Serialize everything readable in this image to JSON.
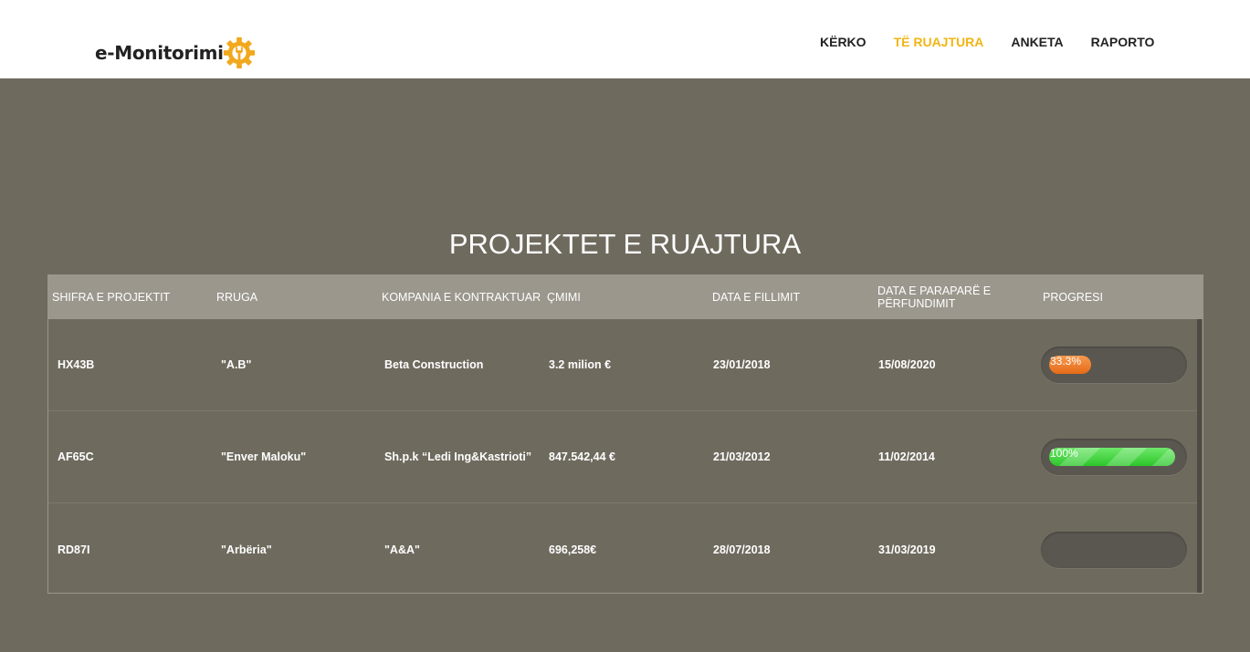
{
  "header": {
    "logo_text": "e-Monitorimi",
    "nav": [
      {
        "label": "KËRKO",
        "active": false
      },
      {
        "label": "TË RUAJTURA",
        "active": true
      },
      {
        "label": "ANKETA",
        "active": false
      },
      {
        "label": "RAPORTO",
        "active": false
      }
    ],
    "accent_color": "#f2b515"
  },
  "main": {
    "title": "PROJEKTET E RUAJTURA",
    "columns": [
      "SHIFRA E PROJEKTIT",
      "RRUGA",
      "KOMPANIA E KONTRAKTUAR",
      "ÇMIMI",
      "DATA E FILLIMIT",
      "DATA E PARAPARË E PËRFUNDIMIT",
      "PROGRESI"
    ],
    "rows": [
      {
        "code": "HX43B",
        "street": "\"A.B\"",
        "company": "Beta Construction",
        "price": "3.2 milion €",
        "start": "23/01/2018",
        "end": "15/08/2020",
        "progress_label": "33.3%",
        "progress": 0.333,
        "progress_color": "#e56a17"
      },
      {
        "code": "AF65C",
        "street": "\"Enver Maloku\"",
        "company": "Sh.p.k “Ledi Ing&Kastrioti”",
        "price": "847.542,44 €",
        "start": "21/03/2012",
        "end": "11/02/2014",
        "progress_label": "100%",
        "progress": 1.0,
        "progress_color": "#2cc62a"
      },
      {
        "code": "RD87I",
        "street": "\"Arbëria\"",
        "company": "\"A&A\"",
        "price": "696,258€",
        "start": "28/07/2018",
        "end": "31/03/2019",
        "progress_label": "",
        "progress": 0,
        "progress_color": ""
      }
    ]
  }
}
